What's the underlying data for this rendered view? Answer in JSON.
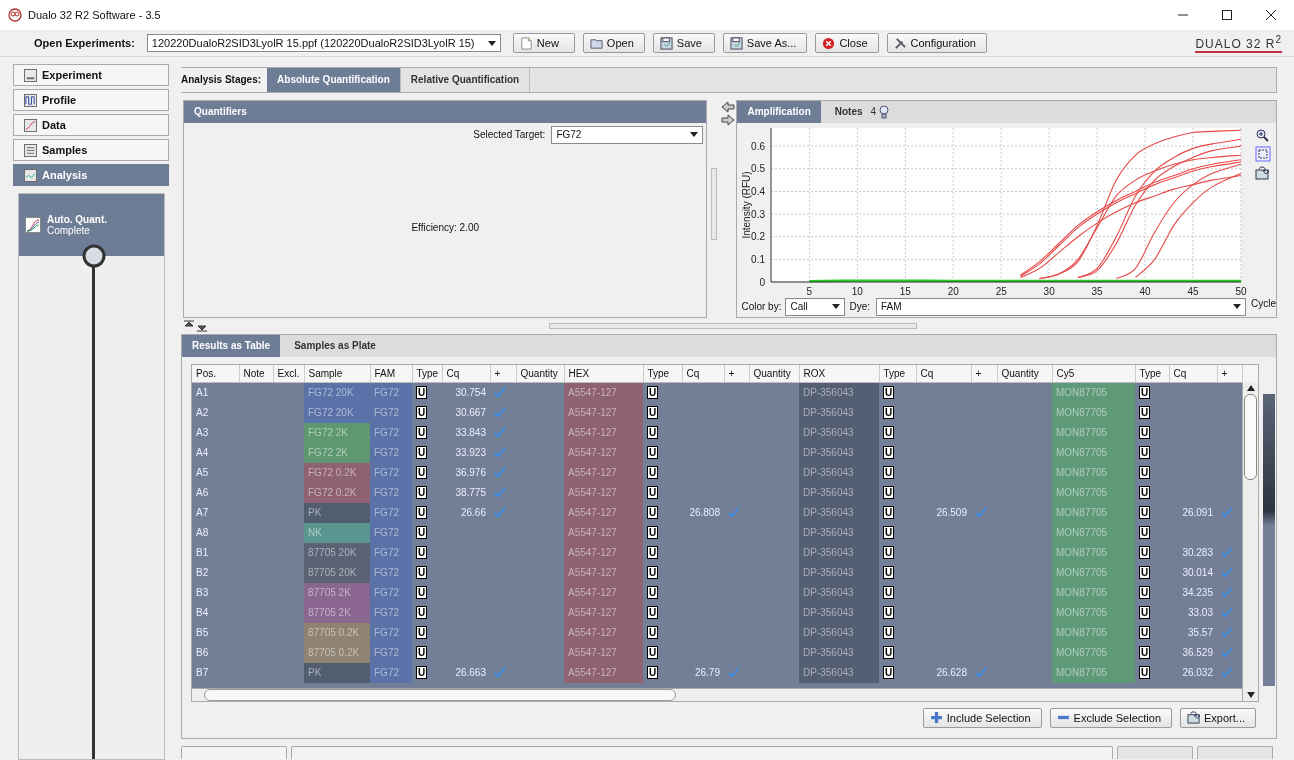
{
  "window": {
    "title": "Dualo 32 R2 Software - 3.5"
  },
  "toolbar": {
    "label": "Open Experiments:",
    "experiment": "120220DualoR2SID3LyolR 15.ppf (120220DualoR2SID3LyolR 15)",
    "buttons": [
      {
        "label": "New",
        "kind": "new"
      },
      {
        "label": "Open",
        "kind": "open"
      },
      {
        "label": "Save",
        "kind": "save"
      },
      {
        "label": "Save As...",
        "kind": "saveas"
      },
      {
        "label": "Close",
        "kind": "close"
      },
      {
        "label": "Configuration",
        "kind": "config"
      }
    ],
    "logo": "DUALO 32 R$^{2}$"
  },
  "sidebar": {
    "items": [
      {
        "label": "Experiment",
        "kind": "experiment",
        "selected": false
      },
      {
        "label": "Profile",
        "kind": "profile",
        "selected": false
      },
      {
        "label": "Data",
        "kind": "data",
        "selected": false
      },
      {
        "label": "Samples",
        "kind": "samples",
        "selected": false
      },
      {
        "label": "Analysis",
        "kind": "analysis",
        "selected": true
      }
    ],
    "stage": {
      "title": "Auto. Quant.",
      "status": "Complete"
    }
  },
  "analysis_stages": {
    "label": "Analysis Stages:",
    "tabs": [
      {
        "label": "Absolute Quantification",
        "selected": true
      },
      {
        "label": "Relative Quantification",
        "selected": false
      }
    ]
  },
  "quantifiers": {
    "title": "Quantifiers",
    "target_label": "Selected Target:",
    "target": "FG72",
    "efficiency": "Efficiency: 2.00"
  },
  "amplification": {
    "tabs": [
      {
        "label": "Amplification",
        "selected": true
      },
      {
        "label": "Notes",
        "selected": false,
        "count": "4"
      }
    ],
    "chart_data": {
      "type": "line",
      "grid": true,
      "xlabel": "Cycle",
      "ylabel": "Intensity (RFU)",
      "x": [
        5,
        10,
        15,
        20,
        25,
        27,
        29,
        31,
        33,
        35,
        37,
        39,
        41,
        43,
        45,
        47,
        50
      ],
      "xlim": [
        1,
        50
      ],
      "ylim": [
        0,
        0.68
      ],
      "xticks": [
        5,
        10,
        15,
        20,
        25,
        30,
        35,
        40,
        45,
        50
      ],
      "yticks": [
        0,
        0.1,
        0.2,
        0.3,
        0.4,
        0.5,
        0.6
      ],
      "series": [
        {
          "color": "#e84848",
          "values": [
            null,
            null,
            null,
            null,
            null,
            0.03,
            0.09,
            0.17,
            0.25,
            0.31,
            0.36,
            0.4,
            0.44,
            0.47,
            0.5,
            0.52,
            0.54
          ]
        },
        {
          "color": "#e84848",
          "values": [
            null,
            null,
            null,
            null,
            null,
            0.025,
            0.08,
            0.16,
            0.24,
            0.3,
            0.35,
            0.39,
            0.43,
            0.46,
            0.49,
            0.51,
            0.53
          ]
        },
        {
          "color": "#e84848",
          "values": [
            null,
            null,
            null,
            null,
            null,
            0.02,
            0.06,
            0.13,
            0.2,
            0.26,
            0.31,
            0.35,
            0.38,
            0.41,
            0.43,
            0.45,
            0.47
          ]
        },
        {
          "color": "#e84848",
          "values": [
            null,
            null,
            null,
            null,
            null,
            null,
            0.015,
            0.035,
            0.09,
            0.25,
            0.45,
            0.56,
            0.61,
            0.64,
            0.66,
            0.665,
            0.67
          ]
        },
        {
          "color": "#e84848",
          "values": [
            null,
            null,
            null,
            null,
            null,
            null,
            0.015,
            0.035,
            0.1,
            0.24,
            0.38,
            0.45,
            0.49,
            0.52,
            0.54,
            0.55,
            0.56
          ]
        },
        {
          "color": "#e84848",
          "values": [
            null,
            null,
            null,
            null,
            null,
            null,
            null,
            null,
            0.02,
            0.06,
            0.2,
            0.38,
            0.49,
            0.55,
            0.59,
            0.61,
            0.63
          ]
        },
        {
          "color": "#e84848",
          "values": [
            null,
            null,
            null,
            null,
            null,
            null,
            null,
            null,
            0.02,
            0.05,
            0.17,
            0.34,
            0.45,
            0.51,
            0.55,
            0.58,
            0.6
          ]
        },
        {
          "color": "#e84848",
          "values": [
            null,
            null,
            null,
            null,
            null,
            null,
            null,
            null,
            null,
            null,
            0.015,
            0.06,
            0.22,
            0.35,
            0.43,
            0.48,
            0.52
          ]
        },
        {
          "color": "#e84848",
          "values": [
            null,
            null,
            null,
            null,
            null,
            null,
            null,
            null,
            null,
            null,
            null,
            0.02,
            0.1,
            0.25,
            0.35,
            0.42,
            0.48
          ]
        },
        {
          "color": "#22d022",
          "values": [
            0.004,
            0.006,
            0.006,
            0.005,
            0.005,
            0.005,
            0.005,
            0.005,
            0.005,
            0.005,
            0.005,
            0.005,
            0.005,
            0.005,
            0.005,
            0.005,
            0.005
          ]
        }
      ]
    },
    "color_by_label": "Color by:",
    "color_by": "Call",
    "dye_label": "Dye:",
    "dye": "FAM"
  },
  "results": {
    "tabs": [
      {
        "label": "Results as Table",
        "selected": true
      },
      {
        "label": "Samples as Plate",
        "selected": false
      }
    ],
    "lead_columns": [
      "Pos.",
      "Note",
      "Excl.",
      "Sample"
    ],
    "dye_groups": [
      {
        "dye": "FAM",
        "color": "#5b72a8",
        "columns": [
          {
            "label": "Type",
            "kind": "type"
          },
          {
            "label": "Cq",
            "kind": "cq"
          },
          {
            "label": "+",
            "kind": "called"
          },
          {
            "label": "Quantity",
            "kind": "quantity"
          }
        ]
      },
      {
        "dye": "HEX",
        "color": "#8f6272",
        "columns": [
          {
            "label": "Type",
            "kind": "type"
          },
          {
            "label": "Cq",
            "kind": "cq"
          },
          {
            "label": "+",
            "kind": "called"
          },
          {
            "label": "Quantity",
            "kind": "quantity"
          }
        ]
      },
      {
        "dye": "ROX",
        "color": "#545f74",
        "columns": [
          {
            "label": "Type",
            "kind": "type"
          },
          {
            "label": "Cq",
            "kind": "cq"
          },
          {
            "label": "+",
            "kind": "called"
          },
          {
            "label": "Quantity",
            "kind": "quantity"
          }
        ]
      },
      {
        "dye": "Cy5",
        "color": "#5e9a78",
        "columns": [
          {
            "label": "Type",
            "kind": "type"
          },
          {
            "label": "Cq",
            "kind": "cq"
          },
          {
            "label": "+",
            "kind": "called"
          }
        ]
      }
    ],
    "rows": [
      {
        "pos": "A1",
        "sample": "FG72 20K",
        "color": "#5b72a8",
        "targets": [
          {
            "name": "FG72",
            "type": "U",
            "cq": "30.754",
            "called": true
          },
          {
            "name": "A5547-127",
            "type": "U",
            "called": false
          },
          {
            "name": "DP-356043",
            "type": "U",
            "called": false
          },
          {
            "name": "MON87705",
            "type": "U",
            "called": false
          }
        ]
      },
      {
        "pos": "A2",
        "sample": "FG72 20K",
        "color": "#5b72a8",
        "targets": [
          {
            "name": "FG72",
            "type": "U",
            "cq": "30.667",
            "called": true
          },
          {
            "name": "A5547-127",
            "type": "U",
            "called": false
          },
          {
            "name": "DP-356043",
            "type": "U",
            "called": false
          },
          {
            "name": "MON87705",
            "type": "U",
            "called": false
          }
        ]
      },
      {
        "pos": "A3",
        "sample": "FG72 2K",
        "color": "#5f9870",
        "targets": [
          {
            "name": "FG72",
            "type": "U",
            "cq": "33.843",
            "called": true
          },
          {
            "name": "A5547-127",
            "type": "U",
            "called": false
          },
          {
            "name": "DP-356043",
            "type": "U",
            "called": false
          },
          {
            "name": "MON87705",
            "type": "U",
            "called": false
          }
        ]
      },
      {
        "pos": "A4",
        "sample": "FG72 2K",
        "color": "#5f9870",
        "targets": [
          {
            "name": "FG72",
            "type": "U",
            "cq": "33.923",
            "called": true
          },
          {
            "name": "A5547-127",
            "type": "U",
            "called": false
          },
          {
            "name": "DP-356043",
            "type": "U",
            "called": false
          },
          {
            "name": "MON87705",
            "type": "U",
            "called": false
          }
        ]
      },
      {
        "pos": "A5",
        "sample": "FG72 0.2K",
        "color": "#8f6272",
        "targets": [
          {
            "name": "FG72",
            "type": "U",
            "cq": "36.976",
            "called": true
          },
          {
            "name": "A5547-127",
            "type": "U",
            "called": false
          },
          {
            "name": "DP-356043",
            "type": "U",
            "called": false
          },
          {
            "name": "MON87705",
            "type": "U",
            "called": false
          }
        ]
      },
      {
        "pos": "A6",
        "sample": "FG72 0.2K",
        "color": "#8f6272",
        "targets": [
          {
            "name": "FG72",
            "type": "U",
            "cq": "38.775",
            "called": true
          },
          {
            "name": "A5547-127",
            "type": "U",
            "called": false
          },
          {
            "name": "DP-356043",
            "type": "U",
            "called": false
          },
          {
            "name": "MON87705",
            "type": "U",
            "called": false
          }
        ]
      },
      {
        "pos": "A7",
        "sample": "PK",
        "color": "#525e70",
        "targets": [
          {
            "name": "FG72",
            "type": "U",
            "cq": "26.66",
            "called": true
          },
          {
            "name": "A5547-127",
            "type": "U",
            "cq": "26.808",
            "called": true
          },
          {
            "name": "DP-356043",
            "type": "U",
            "cq": "26.509",
            "called": true
          },
          {
            "name": "MON87705",
            "type": "U",
            "cq": "26.091",
            "called": true
          }
        ]
      },
      {
        "pos": "A8",
        "sample": "NK",
        "color": "#5a9690",
        "targets": [
          {
            "name": "FG72",
            "type": "U",
            "called": false
          },
          {
            "name": "A5547-127",
            "type": "U",
            "called": false
          },
          {
            "name": "DP-356043",
            "type": "U",
            "called": false
          },
          {
            "name": "MON87705",
            "type": "U",
            "called": false
          }
        ]
      },
      {
        "pos": "B1",
        "sample": "87705 20K",
        "color": "#5a6274",
        "targets": [
          {
            "name": "FG72",
            "type": "U",
            "called": false
          },
          {
            "name": "A5547-127",
            "type": "U",
            "called": false
          },
          {
            "name": "DP-356043",
            "type": "U",
            "called": false
          },
          {
            "name": "MON87705",
            "type": "U",
            "cq": "30.283",
            "called": true
          }
        ]
      },
      {
        "pos": "B2",
        "sample": "87705 20K",
        "color": "#5a6274",
        "targets": [
          {
            "name": "FG72",
            "type": "U",
            "called": false
          },
          {
            "name": "A5547-127",
            "type": "U",
            "called": false
          },
          {
            "name": "DP-356043",
            "type": "U",
            "called": false
          },
          {
            "name": "MON87705",
            "type": "U",
            "cq": "30.014",
            "called": true
          }
        ]
      },
      {
        "pos": "B3",
        "sample": "87705 2K",
        "color": "#8a6690",
        "targets": [
          {
            "name": "FG72",
            "type": "U",
            "called": false
          },
          {
            "name": "A5547-127",
            "type": "U",
            "called": false
          },
          {
            "name": "DP-356043",
            "type": "U",
            "called": false
          },
          {
            "name": "MON87705",
            "type": "U",
            "cq": "34.235",
            "called": true
          }
        ]
      },
      {
        "pos": "B4",
        "sample": "87705 2K",
        "color": "#8a6690",
        "targets": [
          {
            "name": "FG72",
            "type": "U",
            "called": false
          },
          {
            "name": "A5547-127",
            "type": "U",
            "called": false
          },
          {
            "name": "DP-356043",
            "type": "U",
            "called": false
          },
          {
            "name": "MON87705",
            "type": "U",
            "cq": "33.03",
            "called": true
          }
        ]
      },
      {
        "pos": "B5",
        "sample": "87705 0.2K",
        "color": "#8f8270",
        "targets": [
          {
            "name": "FG72",
            "type": "U",
            "called": false
          },
          {
            "name": "A5547-127",
            "type": "U",
            "called": false
          },
          {
            "name": "DP-356043",
            "type": "U",
            "called": false
          },
          {
            "name": "MON87705",
            "type": "U",
            "cq": "35.57",
            "called": true
          }
        ]
      },
      {
        "pos": "B6",
        "sample": "87705 0.2K",
        "color": "#8f8270",
        "targets": [
          {
            "name": "FG72",
            "type": "U",
            "called": false
          },
          {
            "name": "A5547-127",
            "type": "U",
            "called": false
          },
          {
            "name": "DP-356043",
            "type": "U",
            "called": false
          },
          {
            "name": "MON87705",
            "type": "U",
            "cq": "36.529",
            "called": true
          }
        ]
      },
      {
        "pos": "B7",
        "sample": "PK",
        "color": "#525e70",
        "targets": [
          {
            "name": "FG72",
            "type": "U",
            "cq": "26.663",
            "called": true
          },
          {
            "name": "A5547-127",
            "type": "U",
            "cq": "26.79",
            "called": true
          },
          {
            "name": "DP-356043",
            "type": "U",
            "cq": "26.628",
            "called": true
          },
          {
            "name": "MON87705",
            "type": "U",
            "cq": "26.032",
            "called": true
          }
        ]
      }
    ],
    "buttons": [
      {
        "label": "Include Selection",
        "kind": "include"
      },
      {
        "label": "Exclude Selection",
        "kind": "exclude"
      },
      {
        "label": "Export...",
        "kind": "export"
      }
    ]
  }
}
